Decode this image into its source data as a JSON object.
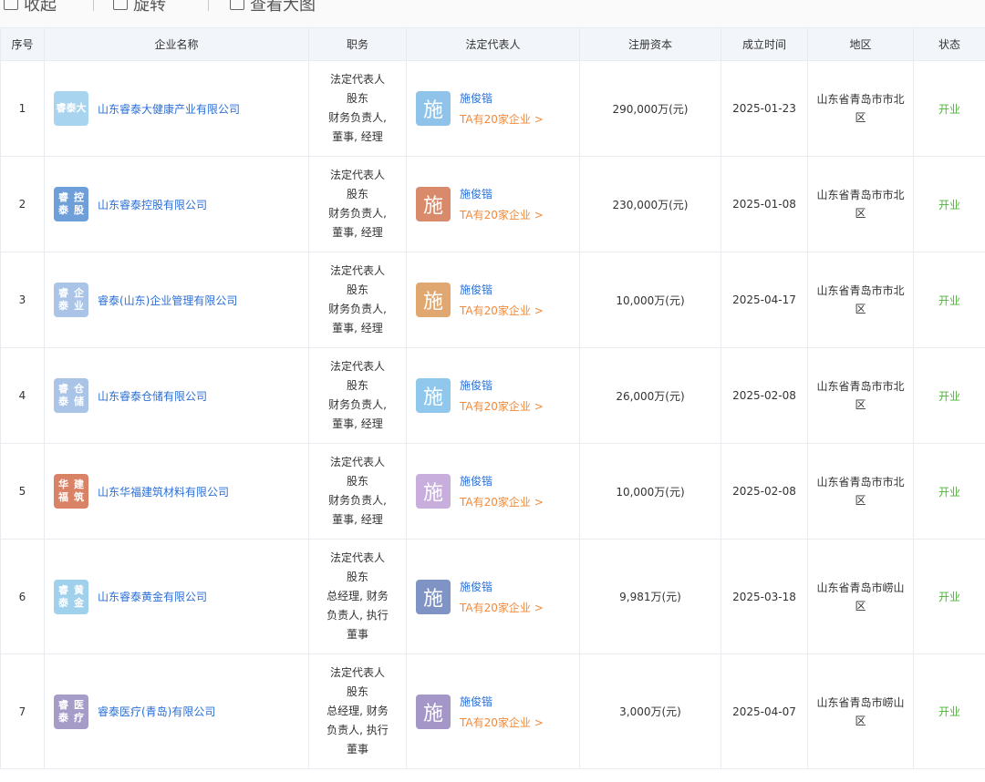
{
  "toolbar": {
    "items": [
      {
        "label": "收起",
        "icon": "collapse-icon"
      },
      {
        "label": "旋转",
        "icon": "rotate-icon"
      },
      {
        "label": "查看大图",
        "icon": "view-large-icon"
      }
    ]
  },
  "table": {
    "headers": {
      "index": "序号",
      "company": "企业名称",
      "duty": "职务",
      "rep": "法定代表人",
      "capital": "注册资本",
      "date": "成立时间",
      "region": "地区",
      "status": "状态"
    },
    "rows": [
      {
        "index": "1",
        "logo_text": "睿泰\n大",
        "logo_color": "#a8d4f0",
        "company": "山东睿泰大健康产业有限公司",
        "duty": [
          "法定代表人",
          "股东",
          "财务负责人,",
          "董事, 经理"
        ],
        "avatar": "施",
        "avatar_color": "#8fc3ea",
        "rep_name": "施俊锴",
        "rep_more": "TA有20家企业 >",
        "capital": "290,000万(元)",
        "date": "2025-01-23",
        "region": "山东省青岛市市北区",
        "status": "开业"
      },
      {
        "index": "2",
        "logo_text": "睿泰\n控股",
        "logo_color": "#6f9fd8",
        "company": "山东睿泰控股有限公司",
        "duty": [
          "法定代表人",
          "股东",
          "财务负责人,",
          "董事, 经理"
        ],
        "avatar": "施",
        "avatar_color": "#d98a6a",
        "rep_name": "施俊锴",
        "rep_more": "TA有20家企业 >",
        "capital": "230,000万(元)",
        "date": "2025-01-08",
        "region": "山东省青岛市市北区",
        "status": "开业"
      },
      {
        "index": "3",
        "logo_text": "睿泰\n企业",
        "logo_color": "#a9c4e6",
        "company": "睿泰(山东)企业管理有限公司",
        "duty": [
          "法定代表人",
          "股东",
          "财务负责人,",
          "董事, 经理"
        ],
        "avatar": "施",
        "avatar_color": "#e0a870",
        "rep_name": "施俊锴",
        "rep_more": "TA有20家企业 >",
        "capital": "10,000万(元)",
        "date": "2025-04-17",
        "region": "山东省青岛市市北区",
        "status": "开业"
      },
      {
        "index": "4",
        "logo_text": "睿泰\n仓储",
        "logo_color": "#a9c4e6",
        "company": "山东睿泰仓储有限公司",
        "duty": [
          "法定代表人",
          "股东",
          "财务负责人,",
          "董事, 经理"
        ],
        "avatar": "施",
        "avatar_color": "#8fc8ec",
        "rep_name": "施俊锴",
        "rep_more": "TA有20家企业 >",
        "capital": "26,000万(元)",
        "date": "2025-02-08",
        "region": "山东省青岛市市北区",
        "status": "开业"
      },
      {
        "index": "5",
        "logo_text": "华福\n建筑",
        "logo_color": "#d98266",
        "company": "山东华福建筑材料有限公司",
        "duty": [
          "法定代表人",
          "股东",
          "财务负责人,",
          "董事, 经理"
        ],
        "avatar": "施",
        "avatar_color": "#c8aedd",
        "rep_name": "施俊锴",
        "rep_more": "TA有20家企业 >",
        "capital": "10,000万(元)",
        "date": "2025-02-08",
        "region": "山东省青岛市市北区",
        "status": "开业"
      },
      {
        "index": "6",
        "logo_text": "睿泰\n黄金",
        "logo_color": "#9fd0ec",
        "company": "山东睿泰黄金有限公司",
        "duty": [
          "法定代表人",
          "股东",
          "总经理, 财务",
          "负责人, 执行",
          "董事"
        ],
        "avatar": "施",
        "avatar_color": "#7f93c4",
        "rep_name": "施俊锴",
        "rep_more": "TA有20家企业 >",
        "capital": "9,981万(元)",
        "date": "2025-03-18",
        "region": "山东省青岛市崂山区",
        "status": "开业"
      },
      {
        "index": "7",
        "logo_text": "睿泰\n医疗",
        "logo_color": "#a69cc8",
        "company": "睿泰医疗(青岛)有限公司",
        "duty": [
          "法定代表人",
          "股东",
          "总经理, 财务",
          "负责人, 执行",
          "董事"
        ],
        "avatar": "施",
        "avatar_color": "#a596c8",
        "rep_name": "施俊锴",
        "rep_more": "TA有20家企业 >",
        "capital": "3,000万(元)",
        "date": "2025-04-07",
        "region": "山东省青岛市崂山区",
        "status": "开业"
      }
    ]
  }
}
